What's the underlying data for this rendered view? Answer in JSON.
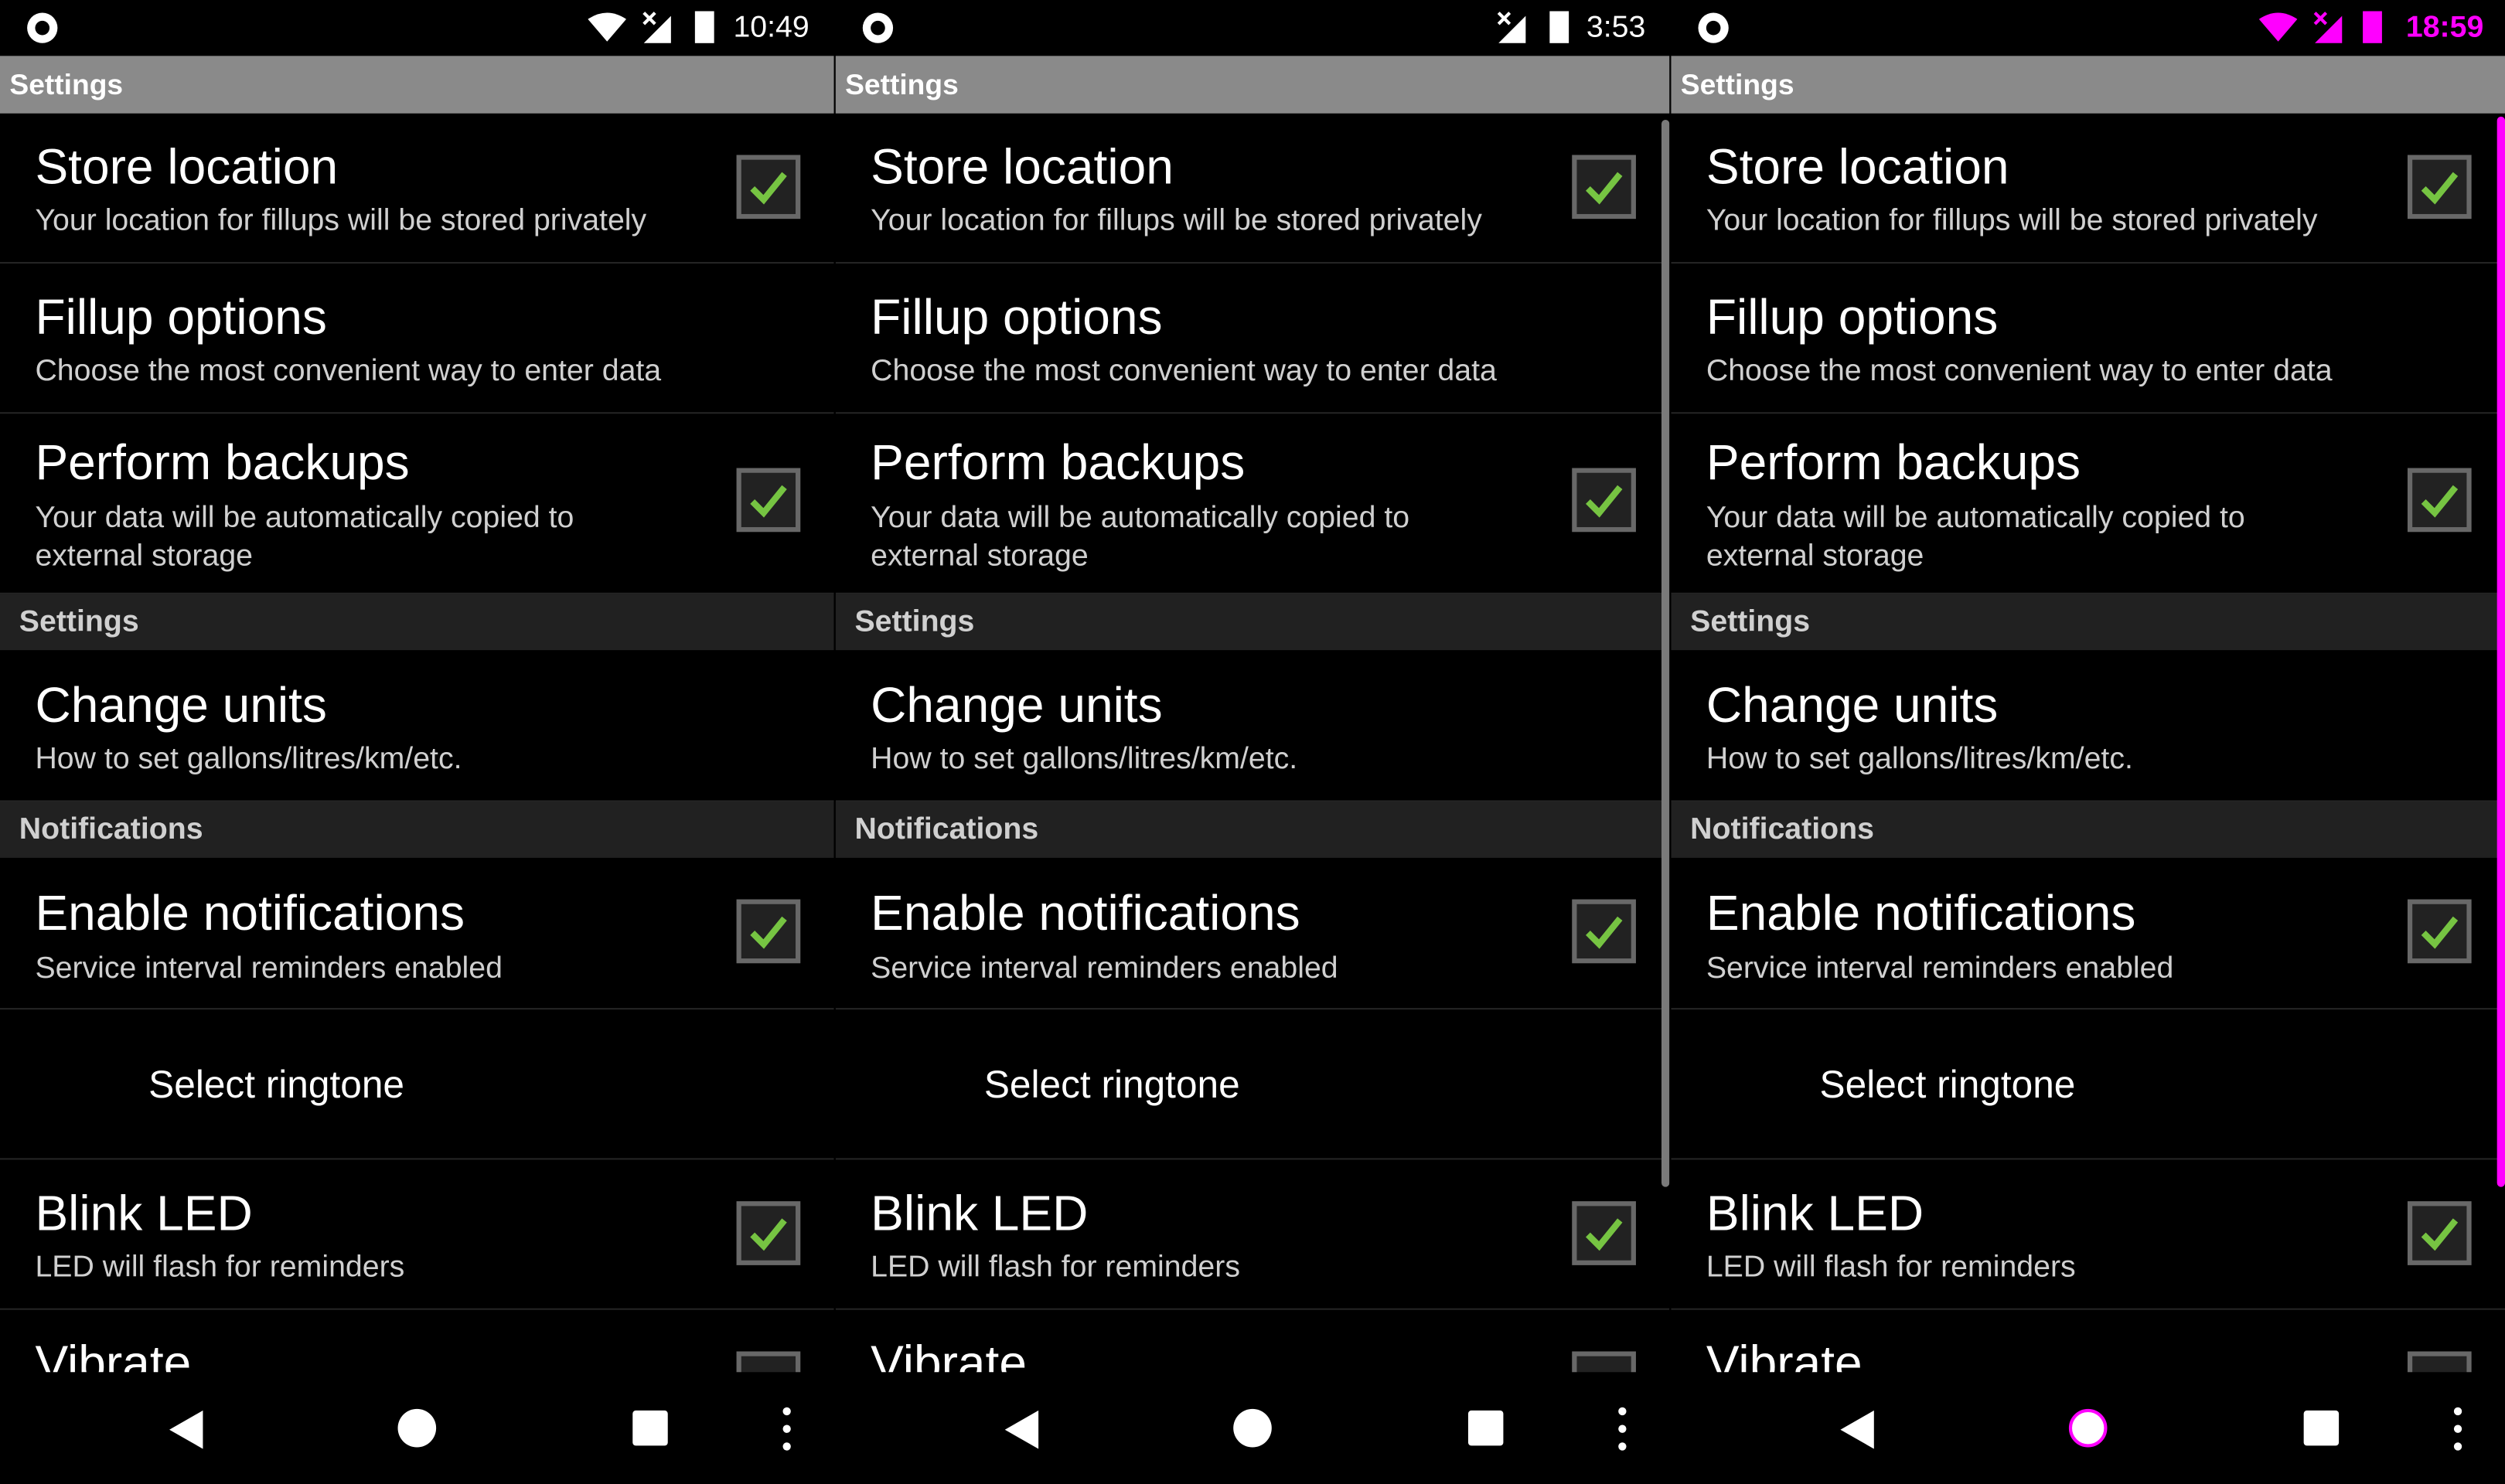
{
  "colors": {
    "background": "#000000",
    "app_bar": "#8a8a8a",
    "section_header": "#212121",
    "checkbox_check": "#76c442",
    "highlight_magenta": "#ff00ff",
    "scrollbar_gray": "#7a7a7a"
  },
  "panels": [
    {
      "status_bar": {
        "time": "10:49",
        "icons": [
          "notification-circle-icon",
          "wifi-icon",
          "no-signal-icon",
          "battery-icon"
        ],
        "accent": "#ffffff"
      },
      "app_bar_title": "Settings",
      "scrollbar": false,
      "preferences": {
        "store_location": {
          "title": "Store location",
          "summary": "Your location for fillups will be stored privately",
          "checked": true
        },
        "fillup_options": {
          "title": "Fillup options",
          "summary": "Choose the most convenient way to enter data"
        },
        "perform_backups": {
          "title": "Perform backups",
          "summary_line1": "Your data will be automatically copied to",
          "summary_line2": "external storage",
          "checked": true
        },
        "settings_header": "Settings",
        "change_units": {
          "title": "Change units",
          "summary": "How to set gallons/litres/km/etc."
        },
        "notifications_header": "Notifications",
        "enable_notifications": {
          "title": "Enable notifications",
          "summary": "Service interval reminders enabled",
          "checked": true
        },
        "select_ringtone": {
          "label": "Select ringtone"
        },
        "blink_led": {
          "title": "Blink LED",
          "summary": "LED will flash for reminders",
          "checked": true
        },
        "vibrate": {
          "title": "Vibrate"
        }
      },
      "nav": [
        "back-icon",
        "home-icon",
        "recents-icon",
        "menu-dots-icon"
      ]
    },
    {
      "status_bar": {
        "time": "3:53",
        "icons": [
          "notification-circle-icon",
          "no-signal-icon",
          "battery-icon"
        ],
        "accent": "#ffffff"
      },
      "app_bar_title": "Settings",
      "scrollbar": true,
      "preferences": {
        "store_location": {
          "title": "Store location",
          "summary": "Your location for fillups will be stored privately",
          "checked": true
        },
        "fillup_options": {
          "title": "Fillup options",
          "summary": "Choose the most convenient way to enter data"
        },
        "perform_backups": {
          "title": "Perform backups",
          "summary_line1": "Your data will be automatically copied to",
          "summary_line2": "external storage",
          "checked": true
        },
        "settings_header": "Settings",
        "change_units": {
          "title": "Change units",
          "summary": "How to set gallons/litres/km/etc."
        },
        "notifications_header": "Notifications",
        "enable_notifications": {
          "title": "Enable notifications",
          "summary": "Service interval reminders enabled",
          "checked": true
        },
        "select_ringtone": {
          "label": "Select ringtone"
        },
        "blink_led": {
          "title": "Blink LED",
          "summary": "LED will flash for reminders",
          "checked": true
        },
        "vibrate": {
          "title": "Vibrate"
        }
      },
      "nav": [
        "back-icon",
        "home-icon",
        "recents-icon",
        "menu-dots-icon"
      ]
    },
    {
      "status_bar": {
        "time": "18:59",
        "icons": [
          "notification-circle-icon",
          "wifi-icon",
          "signal-icon",
          "battery-icon"
        ],
        "accent": "#ff00ff"
      },
      "app_bar_title": "Settings",
      "scrollbar": true,
      "preferences": {
        "store_location": {
          "title": "Store location",
          "summary": "Your location for fillups will be stored privately",
          "checked": true
        },
        "fillup_options": {
          "title": "Fillup options",
          "summary": "Choose the most convenient way to enter data"
        },
        "perform_backups": {
          "title": "Perform backups",
          "summary_line1": "Your data will be automatically copied to",
          "summary_line2": "external storage",
          "checked": true
        },
        "settings_header": "Settings",
        "change_units": {
          "title": "Change units",
          "summary": "How to set gallons/litres/km/etc."
        },
        "notifications_header": "Notifications",
        "enable_notifications": {
          "title": "Enable notifications",
          "summary": "Service interval reminders enabled",
          "checked": true
        },
        "select_ringtone": {
          "label": "Select ringtone"
        },
        "blink_led": {
          "title": "Blink LED",
          "summary": "LED will flash for reminders",
          "checked": true
        },
        "vibrate": {
          "title": "Vibrate"
        }
      },
      "nav": [
        "back-icon",
        "home-icon",
        "recents-icon",
        "menu-dots-icon"
      ]
    }
  ]
}
